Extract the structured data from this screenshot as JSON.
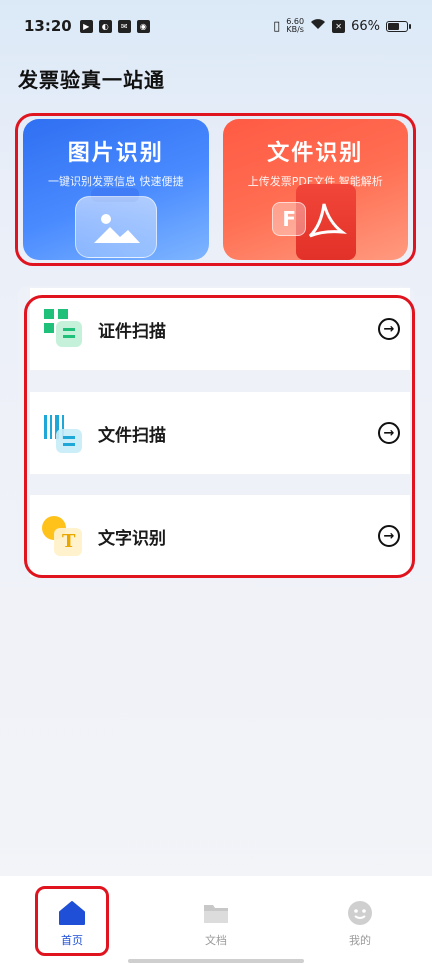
{
  "status_bar": {
    "time": "13:20",
    "speed_value": "6.60",
    "speed_unit": "KB/s",
    "battery": "66%",
    "battery_level": 0.66
  },
  "page": {
    "title": "发票验真一站通"
  },
  "cards": [
    {
      "title": "图片识别",
      "subtitle": "一键识别发票信息 快速便捷",
      "color": "#3a7bf6"
    },
    {
      "title": "文件识别",
      "subtitle": "上传发票PDF文件 智能解析",
      "color": "#ff5c45",
      "badge": "F"
    }
  ],
  "list": [
    {
      "label": "证件扫描",
      "icon": "id-scan-icon",
      "accent": "#1ec07a"
    },
    {
      "label": "文件扫描",
      "icon": "barcode-scan-icon",
      "accent": "#1fa7d8"
    },
    {
      "label": "文字识别",
      "icon": "text-recognition-icon",
      "accent": "#ffc21a",
      "badge": "T"
    }
  ],
  "nav": [
    {
      "label": "首页",
      "icon": "home-icon",
      "active": true
    },
    {
      "label": "文档",
      "icon": "folder-icon",
      "active": false
    },
    {
      "label": "我的",
      "icon": "smiley-icon",
      "active": false
    }
  ],
  "colors": {
    "brand_blue": "#1e4fd6",
    "annotation_red": "#e0141e"
  }
}
